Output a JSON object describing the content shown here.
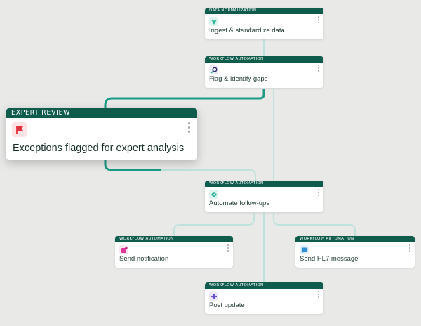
{
  "nodes": {
    "ingest": {
      "category": "DATA NORMALIZATION",
      "label": "Ingest & standardize data",
      "icon": "down-arrow-icon",
      "icon_color": "#2bb39a"
    },
    "flag_gaps": {
      "category": "WORKFLOW AUTOMATION",
      "label": "Flag & identify gaps",
      "icon": "magnify-icon",
      "icon_color": "#2e2a6b"
    },
    "expert": {
      "category": "EXPERT REVIEW",
      "label": "Exceptions flagged for expert analysis",
      "icon": "flag-icon",
      "icon_color": "#e0323a"
    },
    "follow_ups": {
      "category": "WORKFLOW AUTOMATION",
      "label": "Automate follow-ups",
      "icon": "diamond-arrow-icon",
      "icon_color": "#2bb39a"
    },
    "notification": {
      "category": "WORKFLOW AUTOMATION",
      "label": "Send notification",
      "icon": "note-icon",
      "icon_color": "#e2379a"
    },
    "hl7": {
      "category": "WORKFLOW AUTOMATION",
      "label": "Send HL7 message",
      "icon": "message-icon",
      "icon_color": "#2f8fd8"
    },
    "post_update": {
      "category": "WORKFLOW AUTOMATION",
      "label": "Post update",
      "icon": "plus-icon",
      "icon_color": "#6a4fd0"
    }
  },
  "colors": {
    "header": "#0f5b4c",
    "connector_light": "#bfe3dc",
    "connector_strong": "#1a9c86"
  }
}
